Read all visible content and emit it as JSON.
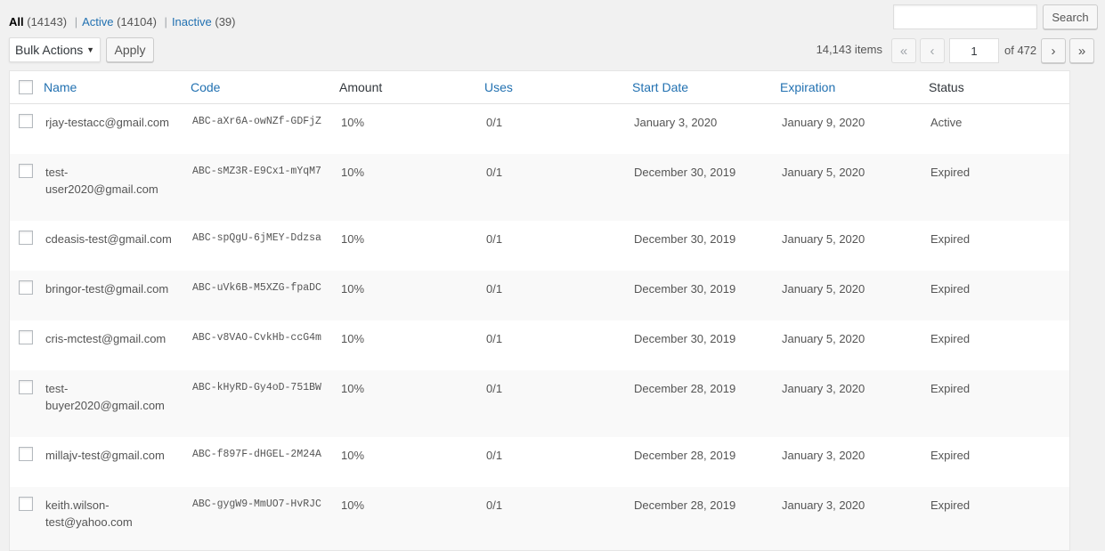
{
  "filters": {
    "all_label": "All",
    "all_count": "(14143)",
    "active_label": "Active",
    "active_count": "(14104)",
    "inactive_label": "Inactive",
    "inactive_count": "(39)",
    "separator": "|"
  },
  "search": {
    "button_label": "Search",
    "value": ""
  },
  "bulk": {
    "selected": "Bulk Actions",
    "apply_label": "Apply"
  },
  "pagination": {
    "items": "14,143 items",
    "first": "«",
    "prev": "‹",
    "next": "›",
    "last": "»",
    "current_page": "1",
    "of_label": "of 472"
  },
  "table": {
    "headers": {
      "name": "Name",
      "code": "Code",
      "amount": "Amount",
      "uses": "Uses",
      "start_date": "Start Date",
      "expiration": "Expiration",
      "status": "Status"
    },
    "rows": [
      {
        "name": "rjay-testacc@gmail.com",
        "code": "ABC-aXr6A-owNZf-GDFjZ",
        "amount": "10%",
        "uses": "0/1",
        "start": "January 3, 2020",
        "expiration": "January 9, 2020",
        "status": "Active"
      },
      {
        "name": "test-user2020@gmail.com",
        "code": "ABC-sMZ3R-E9Cx1-mYqM7",
        "amount": "10%",
        "uses": "0/1",
        "start": "December 30, 2019",
        "expiration": "January 5, 2020",
        "status": "Expired"
      },
      {
        "name": "cdeasis-test@gmail.com",
        "code": "ABC-spQgU-6jMEY-Ddzsa",
        "amount": "10%",
        "uses": "0/1",
        "start": "December 30, 2019",
        "expiration": "January 5, 2020",
        "status": "Expired"
      },
      {
        "name": "bringor-test@gmail.com",
        "code": "ABC-uVk6B-M5XZG-fpaDC",
        "amount": "10%",
        "uses": "0/1",
        "start": "December 30, 2019",
        "expiration": "January 5, 2020",
        "status": "Expired"
      },
      {
        "name": "cris-mctest@gmail.com",
        "code": "ABC-v8VAO-CvkHb-ccG4m",
        "amount": "10%",
        "uses": "0/1",
        "start": "December 30, 2019",
        "expiration": "January 5, 2020",
        "status": "Expired"
      },
      {
        "name": "test-buyer2020@gmail.com",
        "code": "ABC-kHyRD-Gy4oD-751BW",
        "amount": "10%",
        "uses": "0/1",
        "start": "December 28, 2019",
        "expiration": "January 3, 2020",
        "status": "Expired"
      },
      {
        "name": "millajv-test@gmail.com",
        "code": "ABC-f897F-dHGEL-2M24A",
        "amount": "10%",
        "uses": "0/1",
        "start": "December 28, 2019",
        "expiration": "January 3, 2020",
        "status": "Expired"
      },
      {
        "name": "keith.wilson-test@yahoo.com",
        "code": "ABC-gygW9-MmUO7-HvRJC",
        "amount": "10%",
        "uses": "0/1",
        "start": "December 28, 2019",
        "expiration": "January 3, 2020",
        "status": "Expired"
      }
    ]
  }
}
